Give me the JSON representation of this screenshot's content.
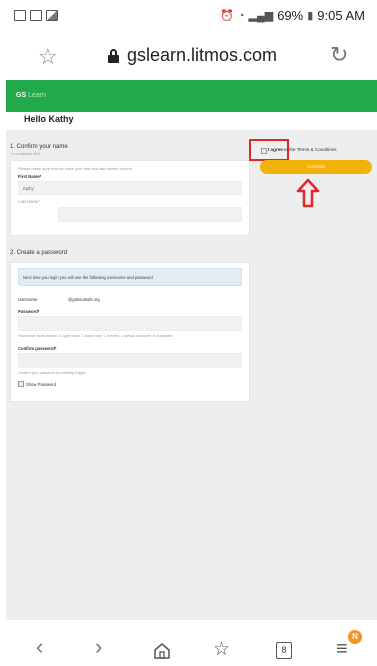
{
  "status_bar": {
    "battery": "69%",
    "time": "9:05 AM"
  },
  "browser": {
    "url": "gslearn.litmos.com",
    "tab_count": "8",
    "badge": "N"
  },
  "site": {
    "brand_prefix": "GS",
    "brand_name": "Learn",
    "greeting": "Hello Kathy"
  },
  "confirm_name": {
    "title": "1. Confirm your name",
    "required_note": "* is a required field",
    "helper": "Please make sure that we have your first and last names correct.",
    "first_name_label": "First Name*",
    "first_name_value": "Kathy",
    "last_name_label": "Last Name*",
    "last_name_value": ""
  },
  "terms": {
    "agree_bold": "I agree",
    "agree_rest": " to the Terms & Conditions",
    "continue_label": "Continue"
  },
  "password": {
    "title": "2. Create a password",
    "info": "Next time you login you will use the following username and password",
    "username_label": "Username",
    "username_value": "@gsboutsofs.org",
    "password_label": "Password*",
    "password_hint": "Passwords must contain: 1 upper case, 1 lower case, 1 number, 1 special character, 8 characters",
    "confirm_label": "Confirm password*",
    "confirm_hint": "Confirm your password by entering it again",
    "show_password_label": "Show Password"
  },
  "colors": {
    "header_green": "#22a94c",
    "continue_yellow": "#f2b308",
    "annotation_red": "#e3262b"
  }
}
